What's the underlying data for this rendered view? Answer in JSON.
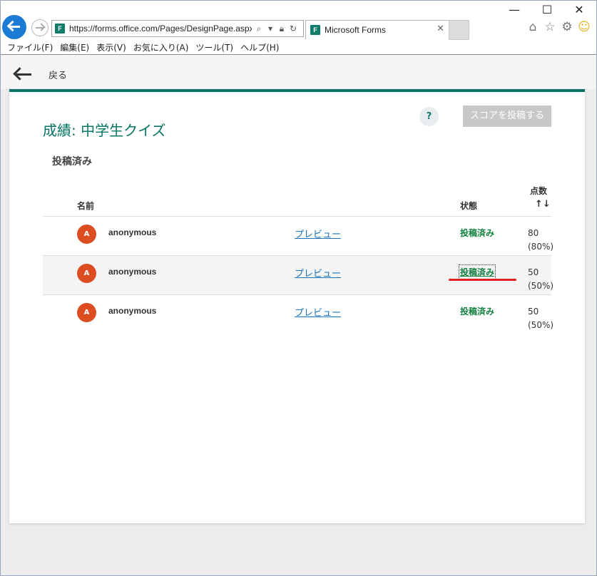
{
  "browser": {
    "url": "https://forms.office.com/Pages/DesignPage.aspx",
    "tab_title": "Microsoft Forms",
    "tab_icon": "forms-icon",
    "window_controls": [
      "minimize-icon",
      "maximize-icon",
      "close-icon"
    ],
    "right_icons": [
      "home-icon",
      "star-icon",
      "gear-icon",
      "smiley-icon"
    ],
    "menu": [
      "ファイル(F)",
      "編集(E)",
      "表示(V)",
      "お気に入り(A)",
      "ツール(T)",
      "ヘルプ(H)"
    ]
  },
  "header": {
    "back_label": "戻る"
  },
  "page": {
    "title": "成績: 中学生クイズ",
    "section": "投稿済み",
    "help_label": "?",
    "post_scores_button": "スコアを投稿する"
  },
  "table": {
    "columns": {
      "name": "名前",
      "status": "状態",
      "score": "点数",
      "sort_icon": "↑↓"
    },
    "rows": [
      {
        "avatar": "A",
        "name": "anonymous",
        "preview": "プレビュー",
        "status": "投稿済み",
        "score": "80",
        "percent": "(80%)"
      },
      {
        "avatar": "A",
        "name": "anonymous",
        "preview": "プレビュー",
        "status": "投稿済み",
        "score": "50",
        "percent": "(50%)"
      },
      {
        "avatar": "A",
        "name": "anonymous",
        "preview": "プレビュー",
        "status": "投稿済み",
        "score": "50",
        "percent": "(50%)"
      }
    ]
  },
  "colors": {
    "accent": "#077564",
    "status_green": "#12813f",
    "avatar_bg": "#dc4d22",
    "link": "#1a73b8",
    "annotation": "#e02020"
  }
}
